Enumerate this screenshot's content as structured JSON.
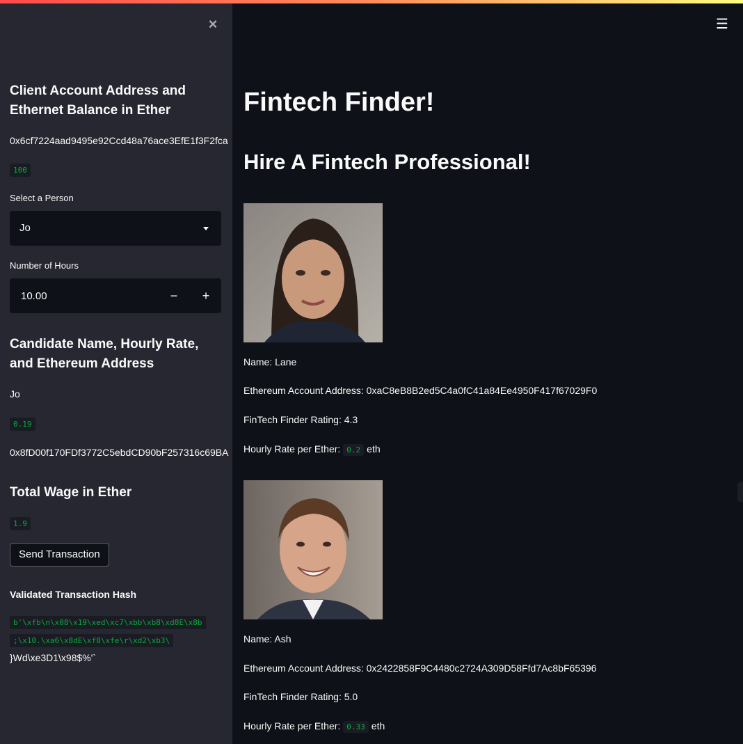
{
  "sidebar": {
    "close_icon": "×",
    "client_heading": "Client Account Address and Ethernet Balance in Ether",
    "client_address": "0x6cf7224aad9495e92Ccd48a76ace3EfE1f3F2fca",
    "client_balance": "100",
    "select_label": "Select a Person",
    "select_value": "Jo",
    "hours_label": "Number of Hours",
    "hours_value": "10.00",
    "minus_label": "−",
    "plus_label": "+",
    "candidate_heading": "Candidate Name, Hourly Rate, and Ethereum Address",
    "candidate_name": "Jo",
    "candidate_rate": "0.19",
    "candidate_address": "0x8fD00f170FDf3772C5ebdCD90bF257316c69BA",
    "wage_heading": "Total Wage in Ether",
    "wage_value": "1.9",
    "send_button": "Send Transaction",
    "hash_heading": "Validated Transaction Hash",
    "hash_line1": "b'\\xfb\\n\\x08\\x19\\xed\\xc7\\xbb\\xb8\\xd8E\\x8b",
    "hash_line2": ";\\x10.\\xa6\\x8dE\\xf8\\xfe\\r\\xd2\\xb3\\",
    "hash_line3": "}Wd\\xe3D1\\x98$%'`"
  },
  "main": {
    "menu_icon": "☰",
    "title": "Fintech Finder!",
    "subtitle": "Hire A Fintech Professional!",
    "candidates": [
      {
        "name_line": "Name: Lane",
        "address_line": "Ethereum Account Address: 0xaC8eB8B2ed5C4a0fC41a84Ee4950F417f67029F0",
        "rating_line": "FinTech Finder Rating: 4.3",
        "rate_prefix": "Hourly Rate per Ether:",
        "rate_value": "0.2",
        "rate_unit": "eth"
      },
      {
        "name_line": "Name: Ash",
        "address_line": "Ethereum Account Address: 0x2422858F9C4480c2724A309D58Ffd7Ac8bF65396",
        "rating_line": "FinTech Finder Rating: 5.0",
        "rate_prefix": "Hourly Rate per Ether:",
        "rate_value": "0.33",
        "rate_unit": "eth"
      }
    ]
  },
  "colors": {
    "sidebar_bg": "#262730",
    "main_bg": "#0e1117",
    "code_green": "#09ab3b",
    "accent_red": "#ff4b4b"
  }
}
